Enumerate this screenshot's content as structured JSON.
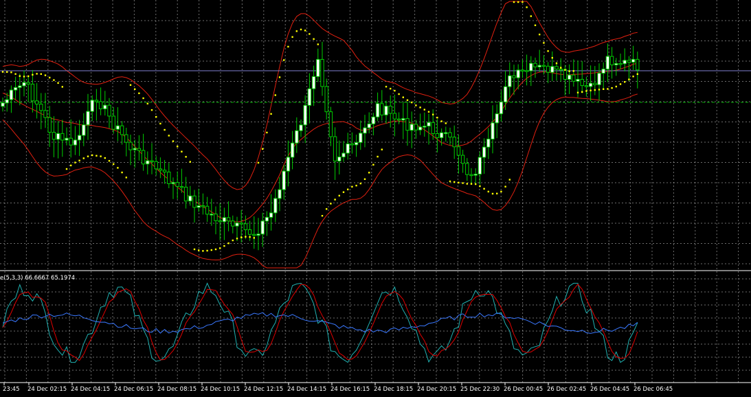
{
  "colors": {
    "background": "#000000",
    "grid": "#c8c8c8",
    "frame": "#ffffff",
    "candle_bull": "#ffffff",
    "candle_outline": "#00d000",
    "bollinger": "#e02010",
    "sar": "#ffff00",
    "price_line": "#7f7fd0",
    "level_line": "#00b000",
    "stoch_main": "#20b0b0",
    "stoch_signal": "#e00000",
    "indicator_blue": "#3a78ff",
    "text": "#ffffff"
  },
  "chart_data": [
    {
      "type": "candlestick",
      "overlays": [
        "bollinger-bands",
        "parabolic-sar"
      ],
      "price_line": "horizontal",
      "grid": true,
      "x_labels": [
        "23:45",
        "24 Dec 02:15",
        "24 Dec 04:15",
        "24 Dec 06:15",
        "24 Dec 08:15",
        "24 Dec 10:15",
        "24 Dec 12:15",
        "24 Dec 14:15",
        "24 Dec 16:15",
        "24 Dec 18:15",
        "24 Dec 20:15",
        "25 Dec 22:30",
        "26 Dec 00:45",
        "26 Dec 02:45",
        "26 Dec 04:45",
        "26 Dec 06:45"
      ]
    },
    {
      "type": "line",
      "indicator_label": "e(5,3,3) 66.6667 65.1974",
      "series_colors": [
        "#20b0b0",
        "#e00000",
        "#3a78ff"
      ],
      "grid": true
    }
  ]
}
